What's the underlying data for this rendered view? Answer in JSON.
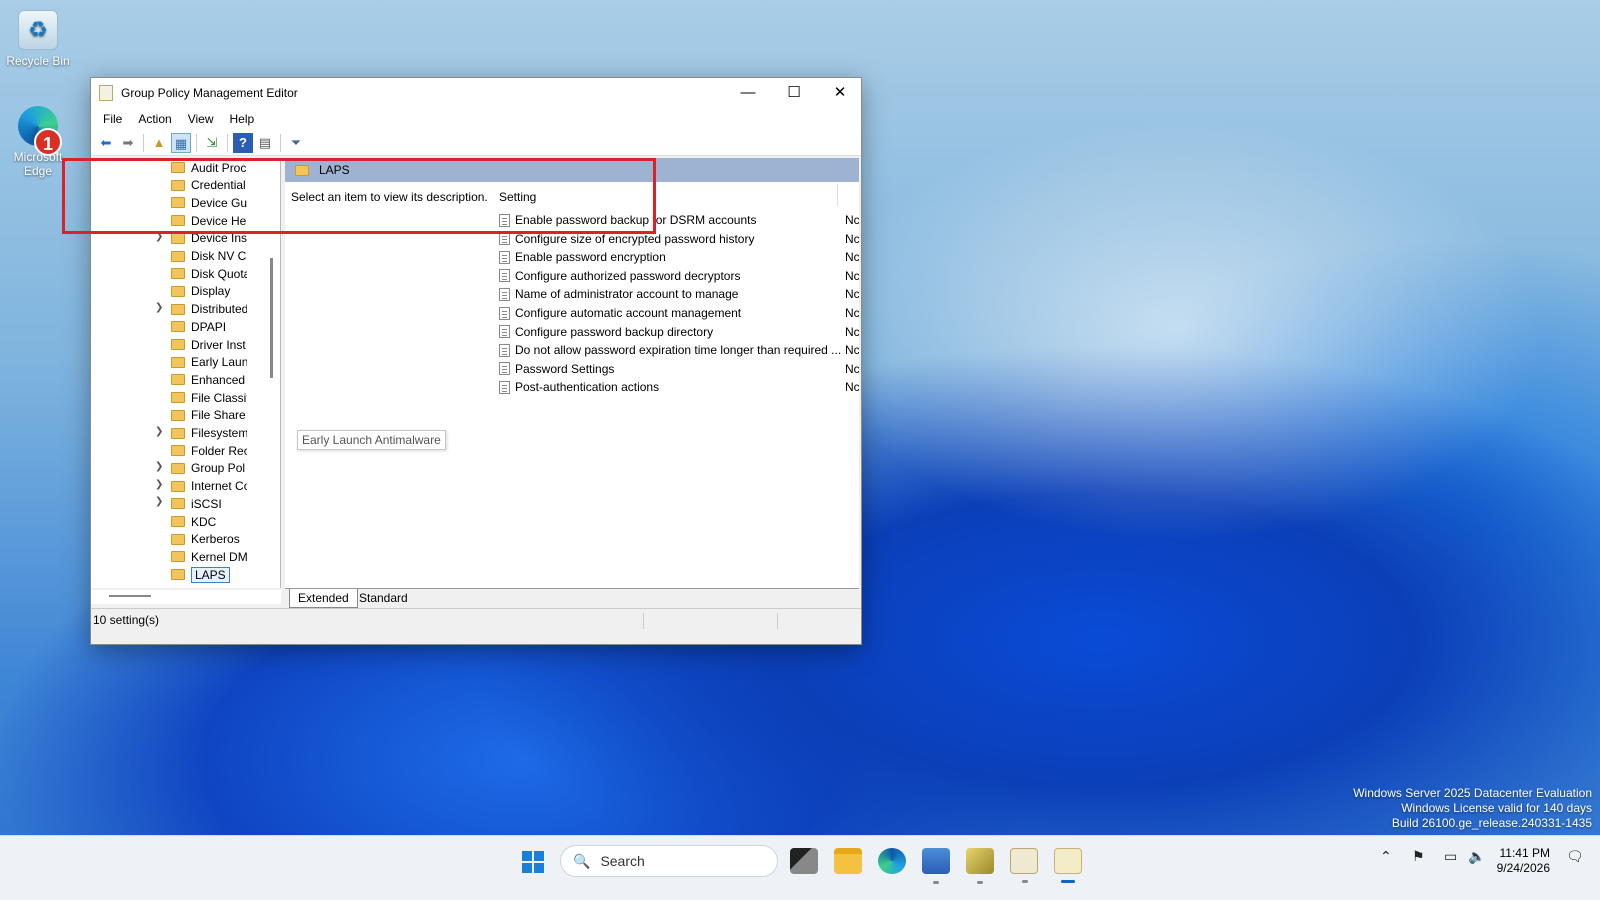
{
  "desktop": {
    "icons": [
      {
        "label": "Recycle Bin"
      },
      {
        "label": "Microsoft Edge"
      }
    ],
    "badge": "1"
  },
  "window": {
    "title": "Group Policy Management Editor",
    "controls": {
      "minimize": "—",
      "maximize": "☐",
      "close": "✕"
    },
    "menu": [
      "File",
      "Action",
      "View",
      "Help"
    ],
    "tree": {
      "items": [
        {
          "label": "Audit Proc",
          "expandable": false
        },
        {
          "label": "Credential",
          "expandable": false
        },
        {
          "label": "Device Gu",
          "expandable": false
        },
        {
          "label": "Device He",
          "expandable": false
        },
        {
          "label": "Device Ins",
          "expandable": true
        },
        {
          "label": "Disk NV Ca",
          "expandable": false
        },
        {
          "label": "Disk Quota",
          "expandable": false
        },
        {
          "label": "Display",
          "expandable": false
        },
        {
          "label": "Distributed",
          "expandable": true
        },
        {
          "label": "DPAPI",
          "expandable": false
        },
        {
          "label": "Driver Inst",
          "expandable": false
        },
        {
          "label": "Early Laun",
          "expandable": false
        },
        {
          "label": "Enhanced",
          "expandable": false
        },
        {
          "label": "File Classif",
          "expandable": false
        },
        {
          "label": "File Share",
          "expandable": false
        },
        {
          "label": "Filesystem",
          "expandable": true
        },
        {
          "label": "Folder Rec",
          "expandable": false
        },
        {
          "label": "Group Pol",
          "expandable": true
        },
        {
          "label": "Internet Co",
          "expandable": true
        },
        {
          "label": "iSCSI",
          "expandable": true
        },
        {
          "label": "KDC",
          "expandable": false
        },
        {
          "label": "Kerberos",
          "expandable": false
        },
        {
          "label": "Kernel DM",
          "expandable": false
        },
        {
          "label": "LAPS",
          "expandable": false,
          "selected": true
        }
      ],
      "tooltip": "Early Launch Antimalware"
    },
    "right": {
      "header": "LAPS",
      "description": "Select an item to view its description.",
      "column": "Setting",
      "settings": [
        {
          "name": "Enable password backup for DSRM accounts",
          "state": "Nc"
        },
        {
          "name": "Configure size of encrypted password history",
          "state": "Nc"
        },
        {
          "name": "Enable password encryption",
          "state": "Nc"
        },
        {
          "name": "Configure authorized password decryptors",
          "state": "Nc"
        },
        {
          "name": "Name of administrator account to manage",
          "state": "Nc"
        },
        {
          "name": "Configure automatic account management",
          "state": "Nc"
        },
        {
          "name": "Configure password backup directory",
          "state": "Nc"
        },
        {
          "name": "Do not allow password expiration time longer than required ...",
          "state": "Nc"
        },
        {
          "name": "Password Settings",
          "state": "Nc"
        },
        {
          "name": "Post-authentication actions",
          "state": "Nc"
        }
      ]
    },
    "tabs": [
      "Extended",
      "Standard"
    ],
    "status": "10 setting(s)"
  },
  "watermark": [
    "Windows Server 2025 Datacenter Evaluation",
    "Windows License valid for 140 days",
    "Build 26100.ge_release.240331-1435"
  ],
  "taskbar": {
    "search_placeholder": "Search",
    "time": "11:41 PM",
    "date": "9/24/2026"
  }
}
